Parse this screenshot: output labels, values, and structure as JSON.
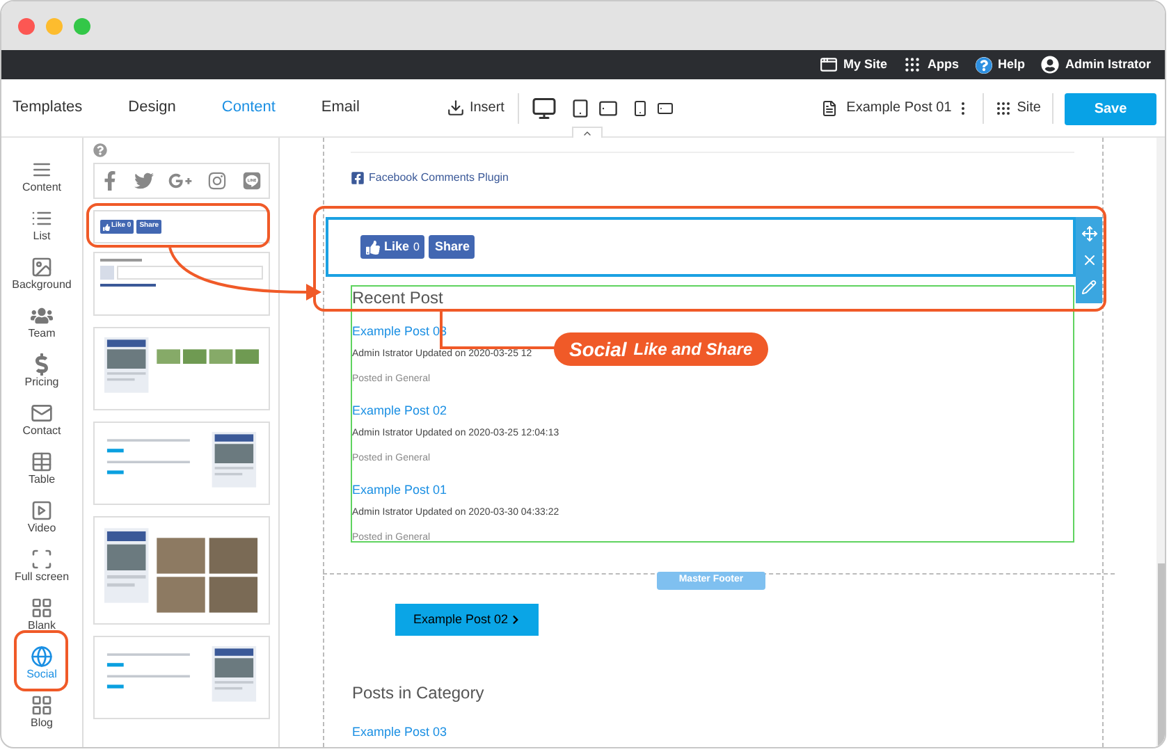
{
  "top_bar": {
    "items": [
      {
        "kind": "site",
        "label": "My Site"
      },
      {
        "kind": "apps",
        "label": "Apps"
      },
      {
        "kind": "help",
        "label": "Help"
      },
      {
        "kind": "user",
        "label": "Admin Istrator"
      }
    ]
  },
  "toolbar": {
    "tabs": [
      {
        "label": "Templates",
        "selected": false
      },
      {
        "label": "Design",
        "selected": false
      },
      {
        "label": "Content",
        "selected": true
      },
      {
        "label": "Email",
        "selected": false
      }
    ],
    "insert": "Insert",
    "page": "Example Post 01",
    "site": "Site",
    "save": "Save"
  },
  "sidebar": {
    "items": [
      {
        "label": "Content",
        "selected": false
      },
      {
        "label": "List",
        "selected": false
      },
      {
        "label": "Background",
        "selected": false
      },
      {
        "label": "Team",
        "selected": false
      },
      {
        "label": "Pricing",
        "selected": false
      },
      {
        "label": "Contact",
        "selected": false
      },
      {
        "label": "Table",
        "selected": false
      },
      {
        "label": "Video",
        "selected": false
      },
      {
        "label": "Full screen",
        "selected": false
      },
      {
        "label": "Blank",
        "selected": false
      },
      {
        "label": "Social",
        "selected": true
      },
      {
        "label": "Blog",
        "selected": false
      }
    ]
  },
  "blocks_panel": {
    "like_thumbnail": {
      "like": "Like 0",
      "share": "Share"
    }
  },
  "canvas": {
    "comments_link": "Facebook Comments Plugin",
    "like_button": {
      "label": "Like",
      "count": "0"
    },
    "share_button": "Share",
    "recent_post": {
      "title": "Recent Post",
      "posts": [
        {
          "title": "Example Post 03",
          "meta": "Admin Istrator Updated on 2020-03-25 12",
          "category": "Posted in General"
        },
        {
          "title": "Example Post 02",
          "meta": "Admin Istrator Updated on 2020-03-25 12:04:13",
          "category": "Posted in General"
        },
        {
          "title": "Example Post 01",
          "meta": "Admin Istrator Updated on 2020-03-30 04:33:22",
          "category": "Posted in General"
        }
      ]
    },
    "footer_label": "Master Footer",
    "next_button": "Example Post 02",
    "category_title": "Posts in Category",
    "category_posts": [
      {
        "title": "Example Post 03"
      }
    ]
  },
  "callout": "**Social** Like and Share"
}
